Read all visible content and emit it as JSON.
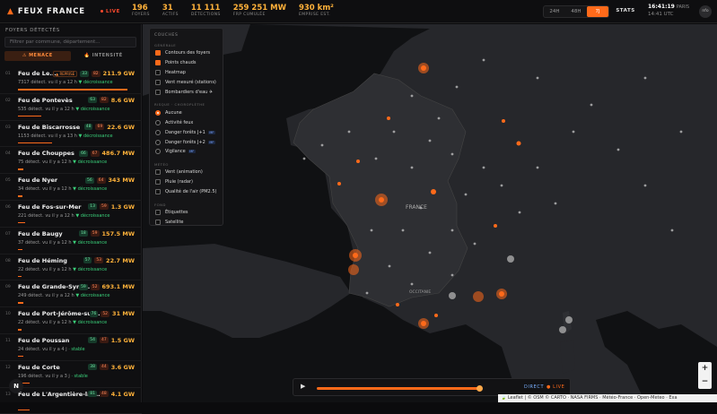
{
  "header": {
    "app_title": "FEUX FRANCE",
    "live_label": "LIVE",
    "stats": [
      {
        "value": "196",
        "label": "FOYERS"
      },
      {
        "value": "31",
        "label": "ACTIFS"
      },
      {
        "value": "11 111",
        "label": "DÉTECTIONS"
      },
      {
        "value": "259 251 MW",
        "label": "FRP CUMULÉE"
      },
      {
        "value": "930 km²",
        "label": "EMPRISE EST."
      }
    ],
    "ranges": [
      "24H",
      "48H",
      "7J"
    ],
    "active_range": "7J",
    "stats_button": "STATS",
    "clock_time": "16:41:19",
    "clock_zone": "PARIS",
    "utc_time": "14:41 UTC",
    "avatar": "nfo"
  },
  "sidebar": {
    "title": "FOYERS DÉTECTÉS",
    "search_placeholder": "Filtrer par commune, département...",
    "tab_menace": "⚠ MENACE",
    "tab_intensite": "🔥 INTENSITÉ",
    "items": [
      {
        "idx": "01",
        "name": "Feu de Le...",
        "reprise": "▲ REPRISE",
        "b1": "33",
        "b2": "82",
        "power": "211.9 GW",
        "detect": "7317 détect.",
        "ago": "vu il y a 12 h",
        "trend": "▼ décroissance",
        "bar": 0.95
      },
      {
        "idx": "02",
        "name": "Feu de Pontevès",
        "reprise": "",
        "b1": "63",
        "b2": "82",
        "power": "8.6 GW",
        "detect": "535 détect.",
        "ago": "vu il y a 12 h",
        "trend": "▼ décroissance",
        "bar": 0.2
      },
      {
        "idx": "03",
        "name": "Feu de Biscarrosse",
        "reprise": "",
        "b1": "48",
        "b2": "69",
        "power": "22.6 GW",
        "detect": "1153 détect.",
        "ago": "vu il y a 13 h",
        "trend": "▼ décroissance",
        "bar": 0.3
      },
      {
        "idx": "04",
        "name": "Feu de Chouppes",
        "reprise": "",
        "b1": "66",
        "b2": "67",
        "power": "486.7 MW",
        "detect": "75 détect.",
        "ago": "vu il y a 12 h",
        "trend": "▼ décroissance",
        "bar": 0.05
      },
      {
        "idx": "05",
        "name": "Feu de Nyer",
        "reprise": "",
        "b1": "56",
        "b2": "64",
        "power": "343 MW",
        "detect": "34 détect.",
        "ago": "vu il y a 12 h",
        "trend": "▼ décroissance",
        "bar": 0.04
      },
      {
        "idx": "06",
        "name": "Feu de Fos-sur-Mer",
        "reprise": "",
        "b1": "13",
        "b2": "59",
        "power": "1.3 GW",
        "detect": "221 détect.",
        "ago": "vu il y a 12 h",
        "trend": "▼ décroissance",
        "bar": 0.06
      },
      {
        "idx": "07",
        "name": "Feu de Baugy",
        "reprise": "",
        "b1": "18",
        "b2": "59",
        "power": "157.5 MW",
        "detect": "37 détect.",
        "ago": "vu il y a 12 h",
        "trend": "▼ décroissance",
        "bar": 0.04
      },
      {
        "idx": "08",
        "name": "Feu de Héming",
        "reprise": "",
        "b1": "57",
        "b2": "53",
        "power": "22.7 MW",
        "detect": "22 détect.",
        "ago": "vu il y a 12 h",
        "trend": "▼ décroissance",
        "bar": 0.03
      },
      {
        "idx": "09",
        "name": "Feu de Grande-Synt...",
        "reprise": "",
        "b1": "59",
        "b2": "52",
        "power": "693.1 MW",
        "detect": "249 détect.",
        "ago": "vu il y a 12 h",
        "trend": "▼ décroissance",
        "bar": 0.05
      },
      {
        "idx": "10",
        "name": "Feu de Port-Jérôme-sur...",
        "reprise": "",
        "b1": "76",
        "b2": "52",
        "power": "31 MW",
        "detect": "22 détect.",
        "ago": "vu il y a 12 h",
        "trend": "▼ décroissance",
        "bar": 0.03
      },
      {
        "idx": "11",
        "name": "Feu de Poussan",
        "reprise": "",
        "b1": "54",
        "b2": "47",
        "power": "1.5 GW",
        "detect": "24 détect.",
        "ago": "vu il y a 4 j",
        "trend": "· stable",
        "bar": 0.05
      },
      {
        "idx": "12",
        "name": "Feu de Corte",
        "reprise": "",
        "b1": "38",
        "b2": "44",
        "power": "3.6 GW",
        "detect": "196 détect.",
        "ago": "vu il y a 3 j",
        "trend": "· stable",
        "bar": 0.1
      },
      {
        "idx": "13",
        "name": "Feu de L'Argentière-la-...",
        "reprise": "",
        "b1": "81",
        "b2": "48",
        "power": "4.1 GW",
        "detect": "",
        "ago": "",
        "trend": "",
        "bar": 0.1
      }
    ]
  },
  "layers": {
    "title": "COUCHES",
    "sec_generale": "GÉNÉRALE",
    "sec_risque": "RISQUE · CHOROPLÈTHE",
    "sec_meteo": "MÉTÉO",
    "sec_fond": "FOND",
    "contours": "Contours des foyers",
    "points": "Points chauds",
    "heatmap": "Heatmap",
    "vent_mesure": "Vent mesuré (stations)",
    "bombardiers": "Bombardiers d'eau ✈",
    "aucune": "Aucune",
    "activite": "Activité feux",
    "danger1": "Danger forêts J+1",
    "danger2": "Danger forêts J+2",
    "vigilance": "Vigilance",
    "mf": "MF",
    "vent_anim": "Vent (animation)",
    "pluie": "Pluie (radar)",
    "qualite": "Qualité de l'air (PM2.5)",
    "etiquettes": "Étiquettes",
    "satellite": "Satellite"
  },
  "map_labels": {
    "france": "FRANCE",
    "occitania": "OCCITANIE"
  },
  "player": {
    "direct": "DIRECT",
    "live": "● LIVE",
    "progress": 0.97
  },
  "attribution": "🍃 Leaflet | © OSM © CARTO · NASA FIRMS · Météo-France · Open-Meteo · Exa",
  "colors": {
    "accent": "#ff6a1a",
    "power": "#ffb23a",
    "trend": "#3ad07a"
  }
}
